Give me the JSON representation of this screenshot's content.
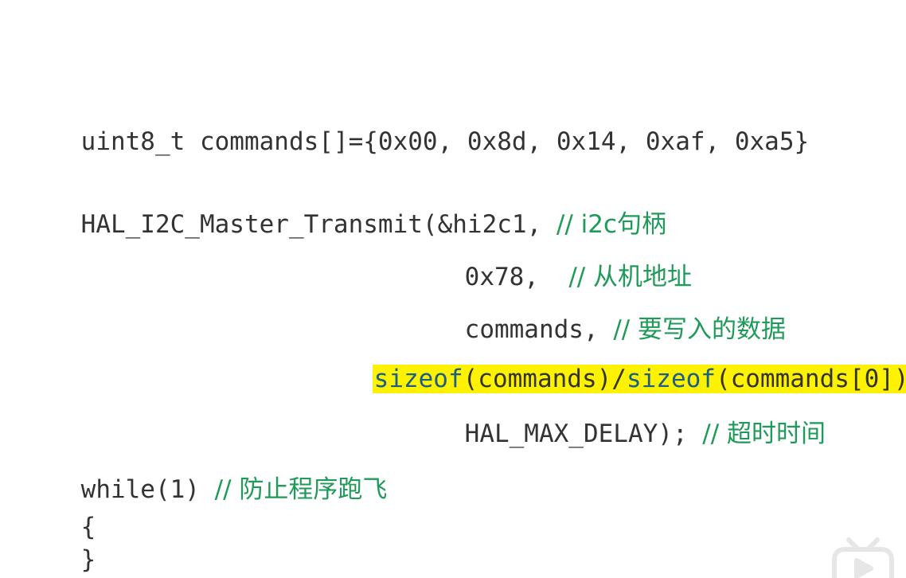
{
  "code": {
    "decl": "uint8_t commands[]={0x00, 0x8d, 0x14, 0xaf, 0xa5}",
    "call_head": "HAL_I2C_Master_Transmit(&hi2c1,",
    "call_head_comment": "// i2c句柄",
    "addr_arg": "0x78,",
    "addr_comment": "// 从机地址",
    "data_arg": "commands,",
    "data_comment": "// 要写入的数据",
    "size_kw1": "sizeof",
    "size_mid": "(commands)/",
    "size_kw2": "sizeof",
    "size_tail": "(commands[0])",
    "timeout_arg": "HAL_MAX_DELAY);",
    "timeout_comment": "// 超时时间",
    "loop": "while(1)",
    "loop_comment": "// 防止程序跑飞",
    "brace_open": "{",
    "brace_close": "}"
  },
  "colors": {
    "code_text": "#333333",
    "comment": "#1f9a58",
    "keyword": "#1b5f86",
    "highlight": "#fff200"
  },
  "icons": {
    "watermark": "bilibili-tv-icon"
  }
}
